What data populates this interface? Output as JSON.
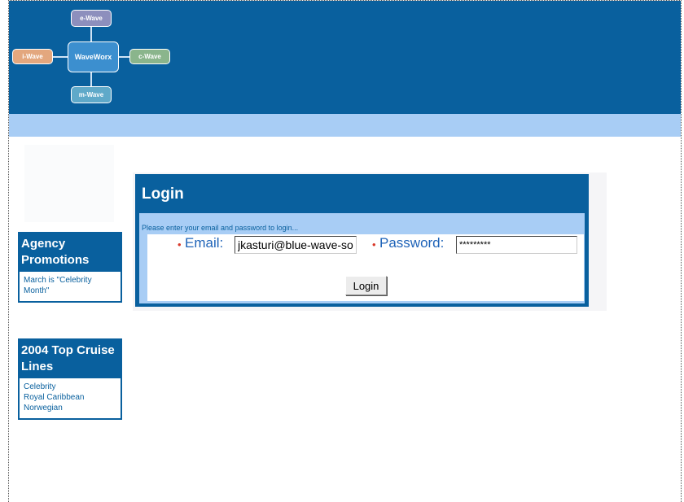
{
  "logo": {
    "top": "e-Wave",
    "left": "i-Wave",
    "center": "WaveWorx",
    "right": "c-Wave",
    "bottom": "m-Wave"
  },
  "sidebar": {
    "promotions": {
      "title": "Agency Promotions",
      "items": [
        "March is \"Celebrity Month\""
      ]
    },
    "cruise_lines": {
      "title": "2004 Top Cruise Lines",
      "items": [
        "Celebrity",
        "Royal Caribbean",
        "Norwegian"
      ]
    }
  },
  "login": {
    "title": "Login",
    "instructions": "Please enter your email and password to login...",
    "required_marker": "•",
    "email_label": "Email:",
    "email_value": "jkasturi@blue-wave-sol",
    "password_label": "Password:",
    "password_value": "*********",
    "button_label": "Login"
  },
  "colors": {
    "brand_blue": "#09609e",
    "light_blue": "#a8cdf5",
    "required_red": "#d93a2b"
  }
}
